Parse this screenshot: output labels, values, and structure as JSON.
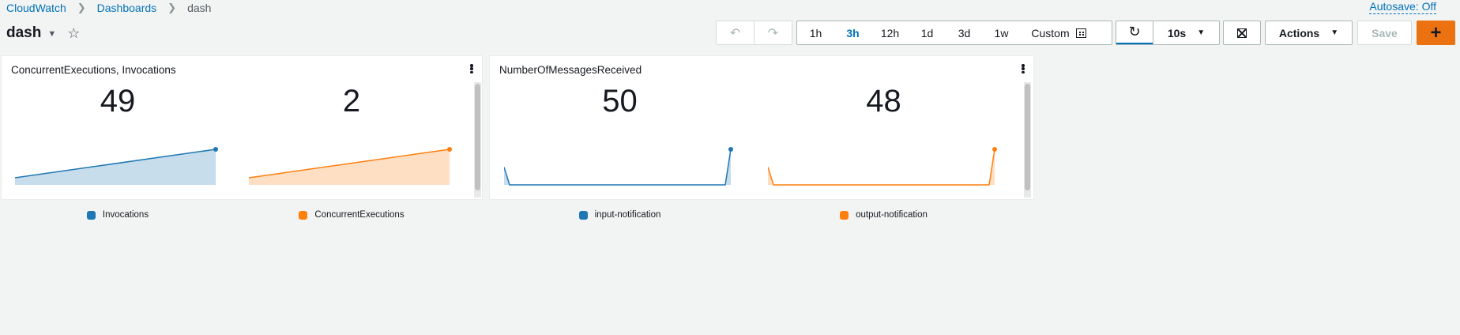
{
  "breadcrumb": {
    "items": [
      "CloudWatch",
      "Dashboards"
    ],
    "current": "dash"
  },
  "autosave": "Autosave: Off",
  "dashboard": {
    "title": "dash"
  },
  "toolbar": {
    "ranges": [
      "1h",
      "3h",
      "12h",
      "1d",
      "3d",
      "1w"
    ],
    "active_range": "3h",
    "custom_label": "Custom",
    "refresh_interval": "10s",
    "actions_label": "Actions",
    "save_label": "Save",
    "add_label": "+"
  },
  "colors": {
    "blue": "#1f77b4",
    "orange": "#ff7f0e",
    "accent": "#ec7211",
    "link": "#0073bb"
  },
  "widgets": [
    {
      "title": "ConcurrentExecutions, Invocations",
      "cells": [
        {
          "value": "49",
          "legend": "Invocations",
          "color": "#1f77b4",
          "sparkline": [
            0.2,
            1.0
          ]
        },
        {
          "value": "2",
          "legend": "ConcurrentExecutions",
          "color": "#ff7f0e",
          "sparkline": [
            0.2,
            1.0
          ]
        }
      ]
    },
    {
      "title": "NumberOfMessagesReceived",
      "cells": [
        {
          "value": "50",
          "legend": "input-notification",
          "color": "#1f77b4",
          "sparkline": [
            0.5,
            0.0,
            0.0,
            0.0,
            1.0
          ]
        },
        {
          "value": "48",
          "legend": "output-notification",
          "color": "#ff7f0e",
          "sparkline": [
            0.5,
            0.0,
            0.0,
            0.0,
            1.0
          ]
        }
      ]
    }
  ]
}
